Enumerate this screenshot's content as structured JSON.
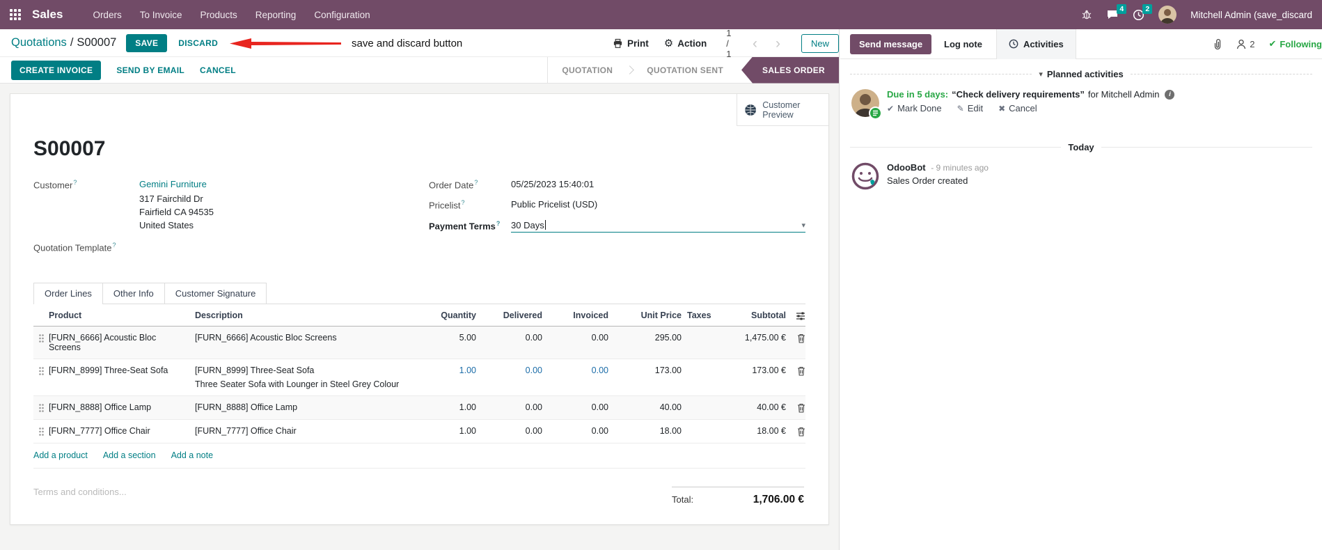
{
  "nav": {
    "app_name": "Sales",
    "menus": [
      "Orders",
      "To Invoice",
      "Products",
      "Reporting",
      "Configuration"
    ],
    "messages_badge": "4",
    "activities_badge": "2",
    "user_name": "Mitchell Admin (save_discard"
  },
  "control_panel": {
    "breadcrumb_parent": "Quotations",
    "breadcrumb_separator": "/",
    "breadcrumb_current": "S00007",
    "save_label": "SAVE",
    "discard_label": "DISCARD",
    "annotation_text": "save and discard button",
    "print_label": "Print",
    "action_label": "Action",
    "pager": "1 / 1",
    "new_label": "New"
  },
  "statusbar": {
    "create_invoice": "CREATE INVOICE",
    "send_by_email": "SEND BY EMAIL",
    "cancel": "CANCEL",
    "stages": [
      "QUOTATION",
      "QUOTATION SENT",
      "SALES ORDER"
    ],
    "active_stage": "SALES ORDER"
  },
  "form": {
    "customer_preview": "Customer Preview",
    "name": "S00007",
    "customer_label": "Customer",
    "customer_value": "Gemini Furniture",
    "address_line1": "317 Fairchild Dr",
    "address_line2": "Fairfield CA 94535",
    "address_line3": "United States",
    "quotation_template_label": "Quotation Template",
    "order_date_label": "Order Date",
    "order_date_value": "05/25/2023 15:40:01",
    "pricelist_label": "Pricelist",
    "pricelist_value": "Public Pricelist (USD)",
    "payment_terms_label": "Payment Terms",
    "payment_terms_value": "30 Days",
    "tabs": [
      "Order Lines",
      "Other Info",
      "Customer Signature"
    ],
    "table": {
      "headers": {
        "product": "Product",
        "description": "Description",
        "quantity": "Quantity",
        "delivered": "Delivered",
        "invoiced": "Invoiced",
        "unit_price": "Unit Price",
        "taxes": "Taxes",
        "subtotal": "Subtotal"
      },
      "rows": [
        {
          "product": "[FURN_6666] Acoustic Bloc Screens",
          "description": "[FURN_6666] Acoustic Bloc Screens",
          "description2": "",
          "quantity": "5.00",
          "delivered": "0.00",
          "invoiced": "0.00",
          "unit_price": "295.00",
          "taxes": "",
          "subtotal": "1,475.00 €"
        },
        {
          "product": "[FURN_8999] Three-Seat Sofa",
          "description": "[FURN_8999] Three-Seat Sofa",
          "description2": "Three Seater Sofa with Lounger in Steel Grey Colour",
          "quantity": "1.00",
          "delivered": "0.00",
          "invoiced": "0.00",
          "unit_price": "173.00",
          "taxes": "",
          "subtotal": "173.00 €"
        },
        {
          "product": "[FURN_8888] Office Lamp",
          "description": "[FURN_8888] Office Lamp",
          "description2": "",
          "quantity": "1.00",
          "delivered": "0.00",
          "invoiced": "0.00",
          "unit_price": "40.00",
          "taxes": "",
          "subtotal": "40.00 €"
        },
        {
          "product": "[FURN_7777] Office Chair",
          "description": "[FURN_7777] Office Chair",
          "description2": "",
          "quantity": "1.00",
          "delivered": "0.00",
          "invoiced": "0.00",
          "unit_price": "18.00",
          "taxes": "",
          "subtotal": "18.00 €"
        }
      ],
      "add_product": "Add a product",
      "add_section": "Add a section",
      "add_note": "Add a note"
    },
    "terms_placeholder": "Terms and conditions...",
    "total_label": "Total:",
    "total_value": "1,706.00 €"
  },
  "chatter": {
    "send_message": "Send message",
    "log_note": "Log note",
    "activities": "Activities",
    "followers_count": "2",
    "following": "Following",
    "planned_title": "Planned activities",
    "activity": {
      "due": "Due in 5 days:",
      "summary": "“Check delivery requirements”",
      "for_text": "for Mitchell Admin",
      "mark_done": "Mark Done",
      "edit": "Edit",
      "cancel": "Cancel"
    },
    "today": "Today",
    "message": {
      "author": "OdooBot",
      "time": "- 9 minutes ago",
      "body": "Sales Order created"
    }
  },
  "icons": {
    "gear": "⚙",
    "caret_down": "▾",
    "chevron_left": "‹",
    "chevron_right": "›",
    "check": "✔",
    "pencil": "✎",
    "cross": "✖",
    "question": "?",
    "info": "i"
  },
  "colors": {
    "brand": "#714B67",
    "accent_teal": "#017E84",
    "badge_teal": "#00A09D",
    "success_green": "#28a745",
    "modified_blue": "#1b6ca8",
    "annotation_red": "#e8251f"
  }
}
